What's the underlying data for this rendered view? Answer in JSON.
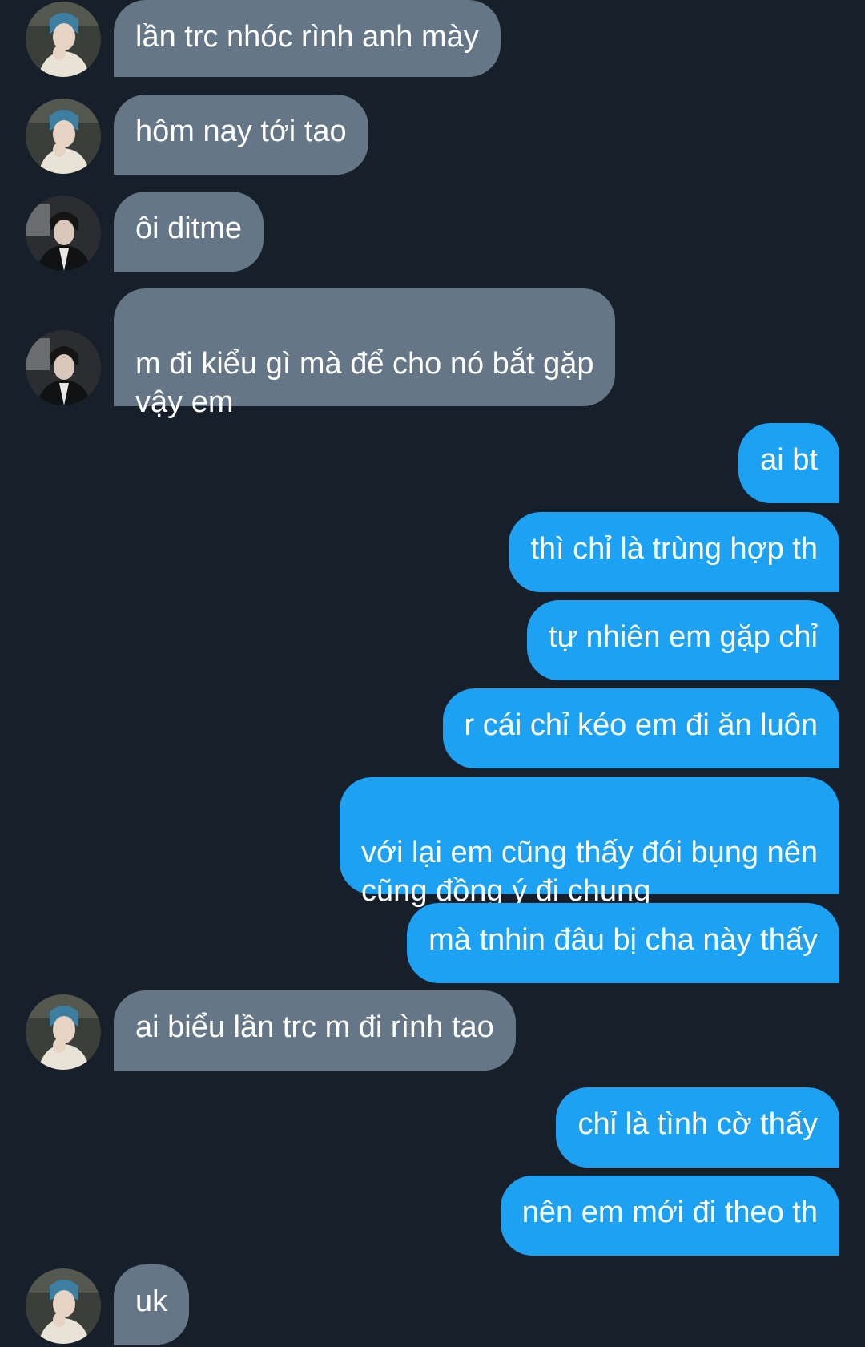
{
  "conversation": {
    "messages": [
      {
        "text": "lần trc nhóc rình anh mày",
        "sender": "other",
        "avatar": "avatar-blue-hair"
      },
      {
        "text": "hôm nay tới tao",
        "sender": "other",
        "avatar": "avatar-blue-hair"
      },
      {
        "text": "ôi ditme",
        "sender": "other",
        "avatar": "avatar-dark-jacket"
      },
      {
        "text": "m đi kiểu gì mà để cho nó bắt gặp\nvậy em",
        "sender": "other",
        "avatar": "avatar-dark-jacket"
      },
      {
        "text": "ai bt",
        "sender": "me"
      },
      {
        "text": "thì chỉ là trùng hợp th",
        "sender": "me"
      },
      {
        "text": "tự nhiên em gặp chỉ",
        "sender": "me"
      },
      {
        "text": "r cái chỉ kéo em đi ăn luôn",
        "sender": "me"
      },
      {
        "text": "với lại em cũng thấy đói bụng nên\ncũng đồng ý đi chung",
        "sender": "me"
      },
      {
        "text": "mà tnhin đâu bị cha này thấy",
        "sender": "me"
      },
      {
        "text": "ai biểu lần trc m đi rình tao",
        "sender": "other",
        "avatar": "avatar-blue-hair"
      },
      {
        "text": "chỉ là tình cờ thấy",
        "sender": "me"
      },
      {
        "text": "nên em mới đi theo th",
        "sender": "me"
      },
      {
        "text": "uk",
        "sender": "other",
        "avatar": "avatar-blue-hair"
      }
    ]
  },
  "colors": {
    "background": "#17202a",
    "incoming_bubble": "#657786",
    "outgoing_bubble": "#1da1f2",
    "text": "#ffffff"
  }
}
